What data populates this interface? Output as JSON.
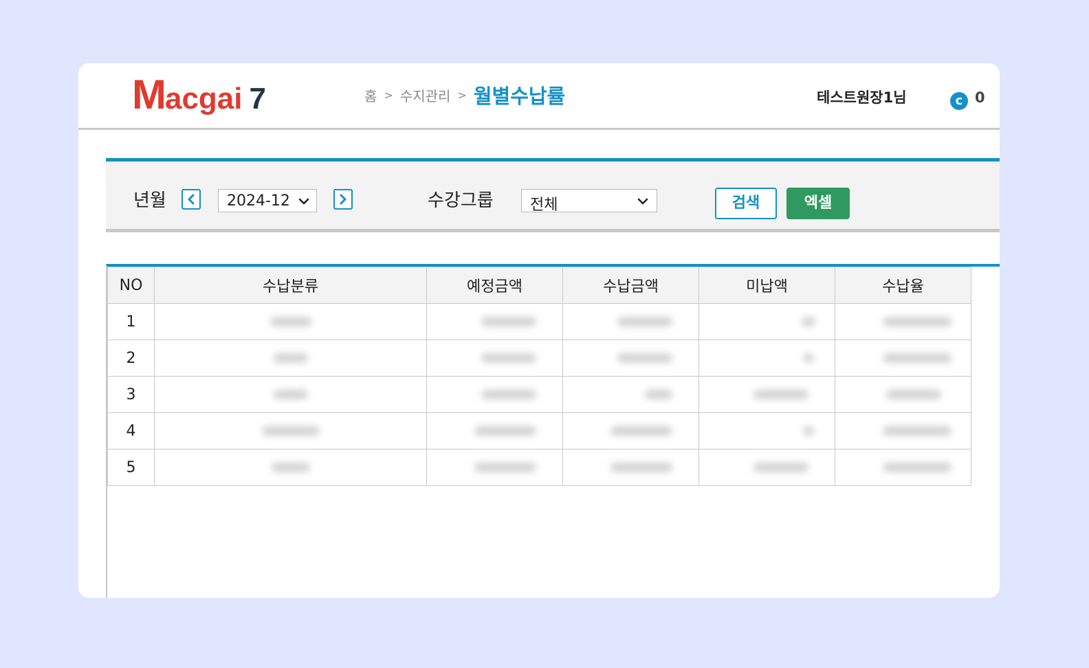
{
  "header": {
    "logo_m": "M",
    "logo_rest": "acgai",
    "logo_num": "7",
    "breadcrumb": [
      "홈",
      "수지관리"
    ],
    "breadcrumb_sep": ">",
    "current_page": "월별수납률",
    "username": "테스트원장1님",
    "coin_icon": "c-coin-icon",
    "coin_glyph": "c",
    "coin_count": "0"
  },
  "filter": {
    "year_month_label": "년월",
    "prev_glyph": "‹",
    "next_glyph": "›",
    "year_month_value": "2024-12",
    "group_label": "수강그룹",
    "group_value": "전체",
    "search_label": "검색",
    "excel_label": "엑셀"
  },
  "table": {
    "columns": [
      "NO",
      "수납분류",
      "예정금액",
      "수납금액",
      "미납액",
      "수납율"
    ],
    "rows": [
      "1",
      "2",
      "3",
      "4",
      "5"
    ]
  },
  "colors": {
    "accent": "#1391c9",
    "excel": "#2f9a5f",
    "logo": "#e03a30",
    "background": "#dfe6fd"
  }
}
